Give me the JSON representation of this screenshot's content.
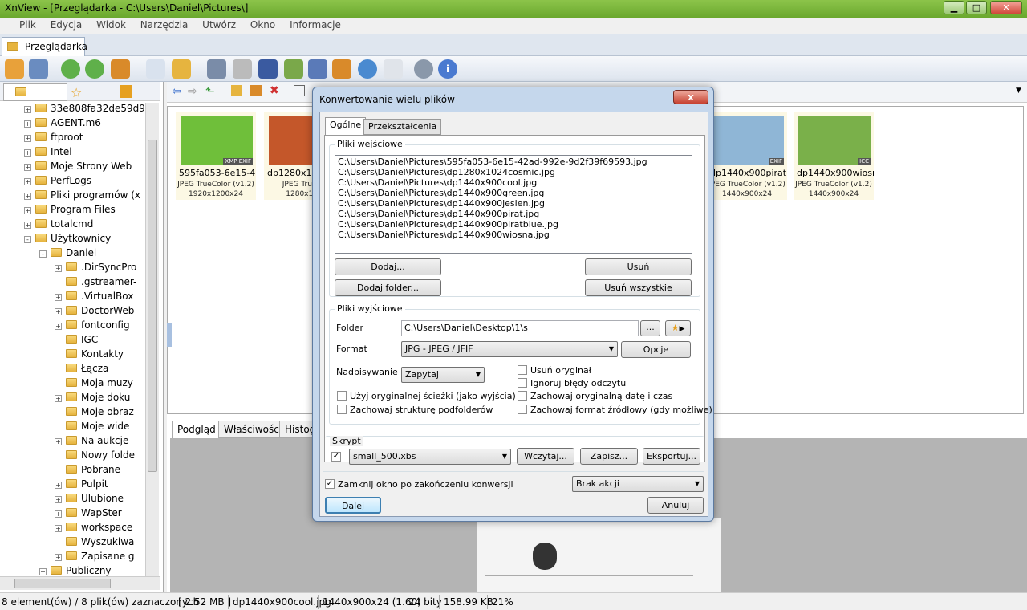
{
  "window": {
    "title": "XnView - [Przeglądarka - C:\\Users\\Daniel\\Pictures\\]"
  },
  "menu": [
    "Plik",
    "Edycja",
    "Widok",
    "Narzędzia",
    "Utwórz",
    "Okno",
    "Informacje"
  ],
  "main_tab": "Przeglądarka",
  "tree": [
    {
      "label": "33e808fa32de59d9",
      "depth": 1,
      "expand": "+"
    },
    {
      "label": "AGENT.m6",
      "depth": 1,
      "expand": "+"
    },
    {
      "label": "ftproot",
      "depth": 1,
      "expand": "+"
    },
    {
      "label": "Intel",
      "depth": 1,
      "expand": "+"
    },
    {
      "label": "Moje Strony Web",
      "depth": 1,
      "expand": "+"
    },
    {
      "label": "PerfLogs",
      "depth": 1,
      "expand": "+"
    },
    {
      "label": "Pliki programów (x",
      "depth": 1,
      "expand": "+"
    },
    {
      "label": "Program Files",
      "depth": 1,
      "expand": "+"
    },
    {
      "label": "totalcmd",
      "depth": 1,
      "expand": "+"
    },
    {
      "label": "Użytkownicy",
      "depth": 1,
      "expand": "-"
    },
    {
      "label": "Daniel",
      "depth": 2,
      "expand": "-"
    },
    {
      "label": ".DirSyncPro",
      "depth": 3,
      "expand": "+"
    },
    {
      "label": ".gstreamer-",
      "depth": 3,
      "expand": ""
    },
    {
      "label": ".VirtualBox",
      "depth": 3,
      "expand": "+"
    },
    {
      "label": "DoctorWeb",
      "depth": 3,
      "expand": "+"
    },
    {
      "label": "fontconfig",
      "depth": 3,
      "expand": "+"
    },
    {
      "label": "IGC",
      "depth": 3,
      "expand": ""
    },
    {
      "label": "Kontakty",
      "depth": 3,
      "expand": ""
    },
    {
      "label": "Łącza",
      "depth": 3,
      "expand": ""
    },
    {
      "label": "Moja muzy",
      "depth": 3,
      "expand": ""
    },
    {
      "label": "Moje doku",
      "depth": 3,
      "expand": "+"
    },
    {
      "label": "Moje obraz",
      "depth": 3,
      "expand": ""
    },
    {
      "label": "Moje wide",
      "depth": 3,
      "expand": ""
    },
    {
      "label": "Na aukcje",
      "depth": 3,
      "expand": "+"
    },
    {
      "label": "Nowy folde",
      "depth": 3,
      "expand": ""
    },
    {
      "label": "Pobrane",
      "depth": 3,
      "expand": ""
    },
    {
      "label": "Pulpit",
      "depth": 3,
      "expand": "+"
    },
    {
      "label": "Ulubione",
      "depth": 3,
      "expand": "+"
    },
    {
      "label": "WapSter",
      "depth": 3,
      "expand": "+"
    },
    {
      "label": "workspace",
      "depth": 3,
      "expand": "+"
    },
    {
      "label": "Wyszukiwa",
      "depth": 3,
      "expand": ""
    },
    {
      "label": "Zapisane g",
      "depth": 3,
      "expand": "+"
    },
    {
      "label": "Publiczny",
      "depth": 2,
      "expand": "+"
    }
  ],
  "thumbnails": [
    {
      "name": "595fa053-6e15-4...",
      "format": "JPEG TrueColor (v1.2)",
      "dims": "1920x1200x24",
      "badge": "XMP EXIF",
      "color": "#6fbf3a"
    },
    {
      "name": "dp1280x102",
      "format": "JPEG TrueCo",
      "dims": "1280x102",
      "badge": "",
      "color": "#c4572a"
    },
    {
      "name": "dp1440x900pirat...",
      "format": "JPEG TrueColor (v1.2)",
      "dims": "1440x900x24",
      "badge": "EXIF",
      "color": "#8fb6d6"
    },
    {
      "name": "dp1440x900wiosna",
      "format": "JPEG TrueColor (v1.2)",
      "dims": "1440x900x24",
      "badge": "ICC",
      "color": "#7ab04a"
    }
  ],
  "bottom_tabs": [
    "Podgląd",
    "Właściwości",
    "Histog"
  ],
  "status": {
    "selection": "8 element(ów) / 8 plik(ów) zaznaczonych",
    "size": "[ 2.52 MB ]",
    "file": "dp1440x900cool.jpg",
    "dims": "1440x900x24 (1.60)",
    "bits": "24 bity",
    "filesize": "158.99 KB",
    "zoom": "21%"
  },
  "dialog": {
    "title": "Konwertowanie wielu plików",
    "close": "x",
    "tabs": [
      "Ogólne",
      "Przekształcenia"
    ],
    "input_group": "Pliki wejściowe",
    "files": [
      "C:\\Users\\Daniel\\Pictures\\595fa053-6e15-42ad-992e-9d2f39f69593.jpg",
      "C:\\Users\\Daniel\\Pictures\\dp1280x1024cosmic.jpg",
      "C:\\Users\\Daniel\\Pictures\\dp1440x900cool.jpg",
      "C:\\Users\\Daniel\\Pictures\\dp1440x900green.jpg",
      "C:\\Users\\Daniel\\Pictures\\dp1440x900jesien.jpg",
      "C:\\Users\\Daniel\\Pictures\\dp1440x900pirat.jpg",
      "C:\\Users\\Daniel\\Pictures\\dp1440x900piratblue.jpg",
      "C:\\Users\\Daniel\\Pictures\\dp1440x900wiosna.jpg"
    ],
    "add": "Dodaj...",
    "remove": "Usuń",
    "add_folder": "Dodaj folder...",
    "remove_all": "Usuń wszystkie",
    "output_group": "Pliki wyjściowe",
    "folder_label": "Folder",
    "folder_value": "C:\\Users\\Daniel\\Desktop\\1\\s",
    "browse": "...",
    "format_label": "Format",
    "format_value": "JPG - JPEG / JFIF",
    "options": "Opcje",
    "overwrite_label": "Nadpisywanie",
    "overwrite_value": "Zapytaj",
    "chk_delete_orig": "Usuń oryginał",
    "chk_ignore_errors": "Ignoruj błędy odczytu",
    "chk_use_orig_path": "Użyj oryginalnej ścieżki (jako wyjścia)",
    "chk_keep_date": "Zachowaj oryginalną datę i czas",
    "chk_keep_struct": "Zachowaj strukturę podfolderów",
    "chk_keep_format": "Zachowaj format źródłowy (gdy możliwe)",
    "script_group": "Skrypt",
    "script_value": "small_500.xbs",
    "load": "Wczytaj...",
    "save": "Zapisz...",
    "export": "Eksportuj...",
    "close_after": "Zamknij okno po zakończeniu konwersji",
    "action_value": "Brak akcji",
    "next": "Dalej",
    "cancel": "Anuluj"
  }
}
